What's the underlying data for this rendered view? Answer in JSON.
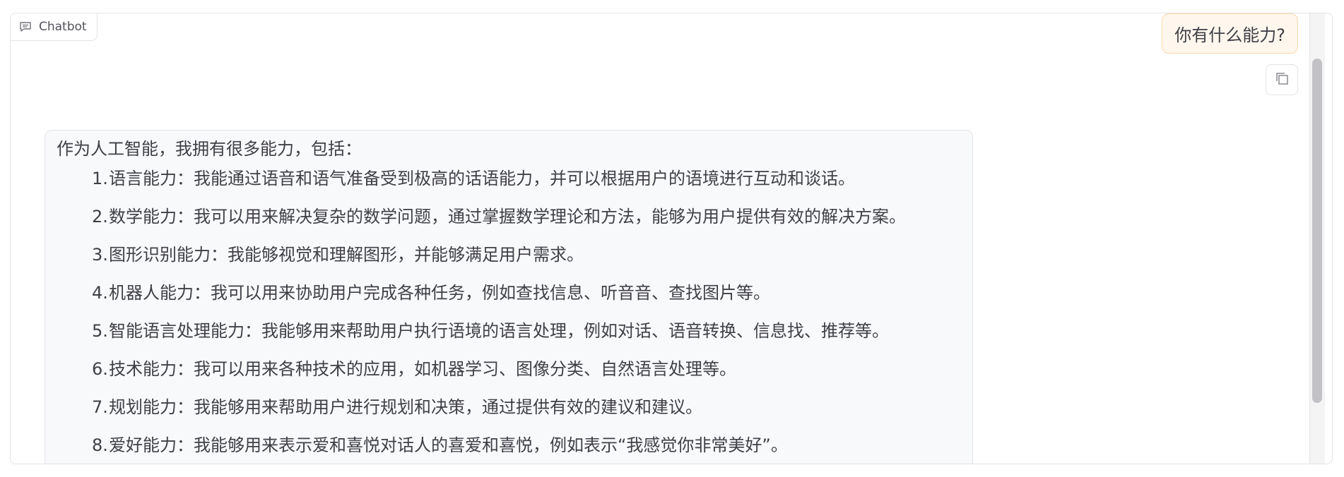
{
  "panel": {
    "label": "Chatbot",
    "label_icon": "chat-icon"
  },
  "user_message": {
    "text": "你有什么能力?",
    "copy_icon": "copy-icon"
  },
  "bot_message": {
    "intro": "作为人工智能，我拥有很多能力，包括：",
    "items": [
      {
        "num": "1.",
        "text": "语言能力：我能通过语音和语气准备受到极高的话语能力，并可以根据用户的语境进行互动和谈话。"
      },
      {
        "num": "2.",
        "text": "数学能力：我可以用来解决复杂的数学问题，通过掌握数学理论和方法，能够为用户提供有效的解决方案。"
      },
      {
        "num": "3.",
        "text": "图形识别能力：我能够视觉和理解图形，并能够满足用户需求。"
      },
      {
        "num": "4.",
        "text": "机器人能力：我可以用来协助用户完成各种任务，例如查找信息、听音音、查找图片等。"
      },
      {
        "num": "5.",
        "text": "智能语言处理能力：我能够用来帮助用户执行语境的语言处理，例如对话、语音转换、信息找、推荐等。"
      },
      {
        "num": "6.",
        "text": "技术能力：我可以用来各种技术的应用，如机器学习、图像分类、自然语言处理等。"
      },
      {
        "num": "7.",
        "text": "规划能力：我能够用来帮助用户进行规划和决策，通过提供有效的建议和建议。"
      },
      {
        "num": "8.",
        "text": "爱好能力：我能够用来表示爱和喜悦对话人的喜爱和喜悦，例如表示“我感觉你非常美好”。"
      }
    ]
  },
  "colors": {
    "user_bubble_bg": "#fff7ed",
    "user_bubble_border": "#fed7aa",
    "bot_bubble_bg": "#f8f9fb"
  }
}
